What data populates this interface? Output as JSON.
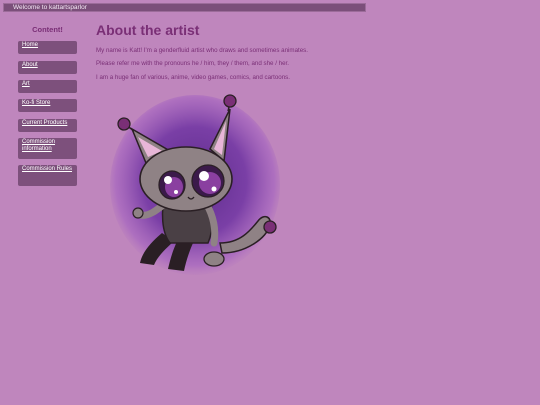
{
  "header": {
    "bar_text": "Welcome to kattartsparlor"
  },
  "sidebar": {
    "title": "Content!",
    "items": [
      {
        "label": "Home"
      },
      {
        "label": "About"
      },
      {
        "label": "Art"
      },
      {
        "label": "Ko-fi Store"
      },
      {
        "label": "Current Products"
      },
      {
        "label": "Commission information"
      },
      {
        "label": "Commission Rules"
      }
    ]
  },
  "main": {
    "heading": "About the artist",
    "paragraphs": [
      "My name is Katt! I'm a genderfluid artist who draws and sometimes animates.",
      "Please refer me with the pronouns he / him, they / them, and she / her.",
      "I am a huge fan of various, anime, video games, comics, and cartoons."
    ]
  },
  "colors": {
    "page_background": "#bf86bd",
    "nav_button": "#7d507c",
    "accent_text": "#7a2f76",
    "art_backdrop": "#7e3fa7"
  },
  "icons": {
    "illustration": "cat-character-illustration"
  }
}
